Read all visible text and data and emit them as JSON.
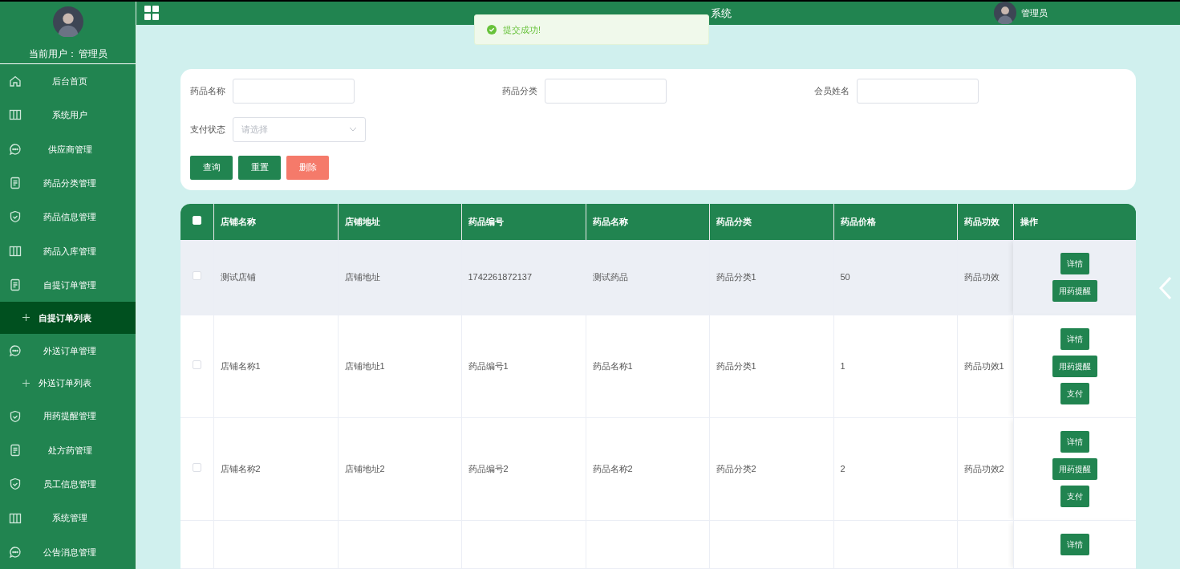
{
  "sidebar": {
    "current_user_label": "当前用户：",
    "current_user": "管理员",
    "items": [
      {
        "kind": "menu",
        "label": "后台首页",
        "selected": false
      },
      {
        "kind": "menu",
        "label": "系统用户",
        "selected": false
      },
      {
        "kind": "menu",
        "label": "供应商管理",
        "selected": false
      },
      {
        "kind": "menu",
        "label": "药品分类管理",
        "selected": false
      },
      {
        "kind": "menu",
        "label": "药品信息管理",
        "selected": false
      },
      {
        "kind": "menu",
        "label": "药品入库管理",
        "selected": false
      },
      {
        "kind": "menu",
        "label": "自提订单管理",
        "selected": false
      },
      {
        "kind": "submenu",
        "label": "自提订单列表",
        "selected": true
      },
      {
        "kind": "menu",
        "label": "外送订单管理",
        "selected": false
      },
      {
        "kind": "submenu",
        "label": "外送订单列表",
        "selected": false
      },
      {
        "kind": "menu",
        "label": "用药提醒管理",
        "selected": false
      },
      {
        "kind": "menu",
        "label": "处方药管理",
        "selected": false
      },
      {
        "kind": "menu",
        "label": "员工信息管理",
        "selected": false
      },
      {
        "kind": "menu",
        "label": "系统管理",
        "selected": false
      },
      {
        "kind": "menu",
        "label": "公告消息管理",
        "selected": false
      }
    ]
  },
  "header": {
    "title": "系统",
    "user": "管理员"
  },
  "toast": {
    "message": "提交成功!"
  },
  "filters": [
    {
      "label": "药品名称",
      "kind": "text"
    },
    {
      "label": "药品分类",
      "kind": "text"
    },
    {
      "label": "会员姓名",
      "kind": "text"
    },
    {
      "label": "支付状态",
      "kind": "select",
      "placeholder": "请选择"
    }
  ],
  "buttons": [
    {
      "label": "查询",
      "kind": "primary"
    },
    {
      "label": "重置",
      "kind": "primary"
    },
    {
      "label": "删除",
      "kind": "danger"
    }
  ],
  "table": {
    "columns": [
      "店铺名称",
      "店铺地址",
      "药品编号",
      "药品名称",
      "药品分类",
      "药品价格",
      "药品功效",
      "操作"
    ],
    "all_checked": false,
    "rows": [
      {
        "checked": false,
        "hovered": true,
        "cells": [
          "测试店铺",
          "店铺地址",
          "1742261872137",
          "测试药品",
          "药品分类1",
          "50",
          "药品功效"
        ],
        "actions": [
          "详情",
          "用药提醒"
        ]
      },
      {
        "checked": false,
        "hovered": false,
        "cells": [
          "店铺名称1",
          "店铺地址1",
          "药品编号1",
          "药品名称1",
          "药品分类1",
          "1",
          "药品功效1"
        ],
        "actions": [
          "详情",
          "用药提醒",
          "支付"
        ]
      },
      {
        "checked": false,
        "hovered": false,
        "cells": [
          "店铺名称2",
          "店铺地址2",
          "药品编号2",
          "药品名称2",
          "药品分类2",
          "2",
          "药品功效2"
        ],
        "actions": [
          "详情",
          "用药提醒",
          "支付"
        ]
      },
      {
        "hovered": false,
        "actions": [
          "详情"
        ]
      }
    ]
  }
}
